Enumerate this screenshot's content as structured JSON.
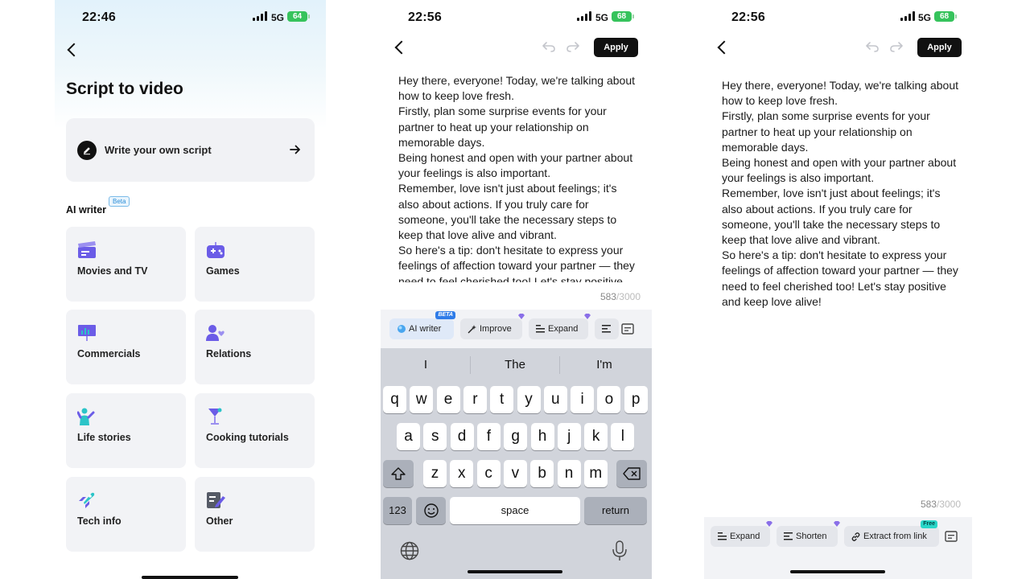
{
  "screen1": {
    "status": {
      "time": "22:46",
      "network": "5G",
      "battery": "64"
    },
    "title": "Script to video",
    "write_own": "Write your own script",
    "ai_writer": {
      "label": "AI writer",
      "badge": "Beta"
    },
    "categories": [
      {
        "label": "Movies and TV",
        "icon": "clapperboard-icon"
      },
      {
        "label": "Games",
        "icon": "gamepad-icon"
      },
      {
        "label": "Commercials",
        "icon": "presentation-board-icon"
      },
      {
        "label": "Relations",
        "icon": "people-heart-icon"
      },
      {
        "label": "Life stories",
        "icon": "person-waving-icon"
      },
      {
        "label": "Cooking tutorials",
        "icon": "cocktail-glass-icon"
      },
      {
        "label": "Tech info",
        "icon": "rocket-icon"
      },
      {
        "label": "Other",
        "icon": "note-edit-icon"
      }
    ],
    "colors": {
      "accent": "#6b5ce7",
      "teal": "#2bc4c8"
    }
  },
  "screen2": {
    "status": {
      "time": "22:56",
      "network": "5G",
      "battery": "68"
    },
    "apply": "Apply",
    "script_text": "Hey there, everyone! Today, we're talking about how to keep love fresh.\nFirstly, plan some surprise events for your partner to heat up your relationship on memorable days.\nBeing honest and open with your partner about your feelings is also important.\nRemember, love isn't just about feelings; it's also about actions. If you truly care for someone, you'll take the necessary steps to keep that love alive and vibrant.\nSo here's a tip: don't hesitate to express your feelings of affection toward your partner — they need to feel cherished too! Let's stay positive and keep love alive!",
    "count": "583",
    "max": "/3000",
    "tools": {
      "ai_writer": "AI writer",
      "ai_badge": "BETA",
      "improve": "Improve",
      "expand": "Expand"
    },
    "suggestions": [
      "I",
      "The",
      "I'm"
    ],
    "keyboard": {
      "row1": [
        "q",
        "w",
        "e",
        "r",
        "t",
        "y",
        "u",
        "i",
        "o",
        "p"
      ],
      "row2": [
        "a",
        "s",
        "d",
        "f",
        "g",
        "h",
        "j",
        "k",
        "l"
      ],
      "row3": [
        "z",
        "x",
        "c",
        "v",
        "b",
        "n",
        "m"
      ],
      "numbers": "123",
      "space": "space",
      "return": "return"
    }
  },
  "screen3": {
    "status": {
      "time": "22:56",
      "network": "5G",
      "battery": "68"
    },
    "apply": "Apply",
    "script_text": "Hey there, everyone! Today, we're talking about how to keep love fresh.\nFirstly, plan some surprise events for your partner to heat up your relationship on memorable days.\nBeing honest and open with your partner about your feelings is also important.\nRemember, love isn't just about feelings; it's also about actions. If you truly care for someone, you'll take the necessary steps to keep that love alive and vibrant.\nSo here's a tip: don't hesitate to express your feelings of affection toward your partner — they need to feel cherished too! Let's stay positive and keep love alive!",
    "count": "583",
    "max": "/3000",
    "tools": {
      "expand": "Expand",
      "shorten": "Shorten",
      "extract": "Extract from link",
      "free_badge": "Free"
    }
  }
}
